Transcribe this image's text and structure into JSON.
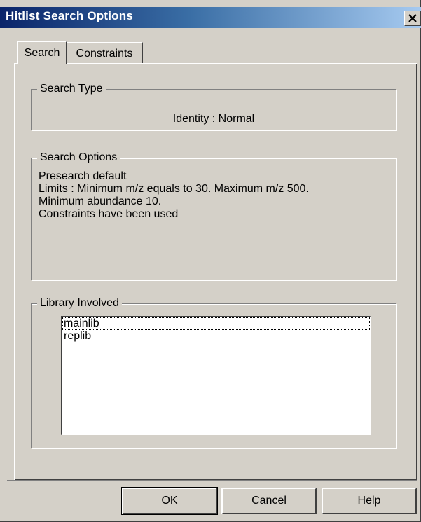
{
  "window": {
    "title": "Hitlist Search Options"
  },
  "tabs": [
    {
      "label": "Search"
    },
    {
      "label": "Constraints"
    }
  ],
  "search_type": {
    "legend": "Search Type",
    "value": "Identity : Normal"
  },
  "search_options": {
    "legend": "Search Options",
    "lines": [
      "Presearch default",
      "Limits : Minimum m/z equals to 30. Maximum m/z 500.",
      "Minimum abundance 10.",
      "Constraints have been used"
    ]
  },
  "library": {
    "legend": "Library Involved",
    "items": [
      "mainlib",
      "replib"
    ]
  },
  "buttons": {
    "ok": "OK",
    "cancel": "Cancel",
    "help": "Help"
  },
  "icons": {
    "close": "close-icon"
  }
}
